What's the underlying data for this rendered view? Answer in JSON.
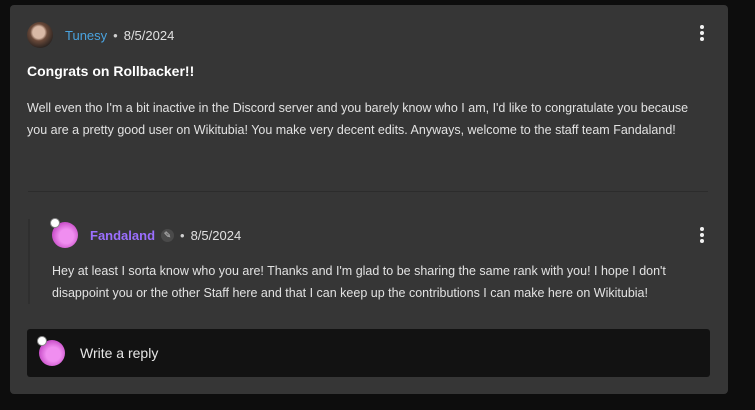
{
  "post": {
    "author": "Tunesy",
    "separator": "•",
    "date": "8/5/2024",
    "title": "Congrats on Rollbacker!!",
    "body": "Well even tho I'm a bit inactive in the Discord server and you barely know who I am, I'd like to congratulate you because you are a pretty good user on Wikitubia! You make very decent edits. Anyways, welcome to the staff team Fandaland!"
  },
  "reply": {
    "author": "Fandaland",
    "separator": "•",
    "date": "8/5/2024",
    "body": "Hey at least I sorta know who you are! Thanks and I'm glad to be sharing the same rank with you! I hope I don't disappoint you or the other Staff here and that I can keep up the contributions I can make here on Wikitubia!"
  },
  "reply_box": {
    "placeholder": "Write a reply"
  },
  "colors": {
    "card": "#363636",
    "author_link": "#4aa3df",
    "reply_author": "#9b6fff"
  },
  "icons": {
    "post_menu": "kebab-menu-icon",
    "reply_menu": "kebab-menu-icon",
    "badge": "pencil-icon"
  }
}
